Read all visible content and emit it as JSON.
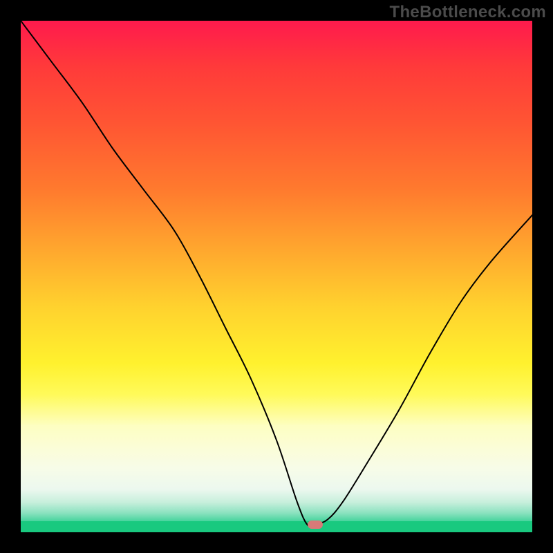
{
  "watermark": "TheBottleneck.com",
  "chart_data": {
    "type": "line",
    "title": "",
    "xlabel": "",
    "ylabel": "",
    "xlim": [
      0,
      100
    ],
    "ylim": [
      0,
      100
    ],
    "grid": false,
    "legend": false,
    "series": [
      {
        "name": "bottleneck-curve",
        "x": [
          0,
          6,
          12,
          18,
          24,
          30,
          35,
          40,
          45,
          50,
          54,
          56,
          57.5,
          60,
          63,
          68,
          74,
          80,
          86,
          92,
          100
        ],
        "y": [
          100,
          92,
          84,
          75,
          67,
          59,
          50,
          40,
          30,
          18,
          6,
          1.5,
          1.5,
          2.5,
          6,
          14,
          24,
          35,
          45,
          53,
          62
        ]
      }
    ],
    "annotations": [
      {
        "name": "optimal-marker",
        "x": 57.5,
        "y": 1.5
      }
    ],
    "background": {
      "type": "vertical-gradient",
      "stops": [
        {
          "pos": 0.0,
          "color": "#ff1a4d"
        },
        {
          "pos": 0.2,
          "color": "#ff5533"
        },
        {
          "pos": 0.45,
          "color": "#ffa82e"
        },
        {
          "pos": 0.67,
          "color": "#fff12e"
        },
        {
          "pos": 0.79,
          "color": "#fdfec1"
        },
        {
          "pos": 0.9,
          "color": "#8be2bf"
        },
        {
          "pos": 1.0,
          "color": "#19c97f"
        }
      ]
    }
  }
}
